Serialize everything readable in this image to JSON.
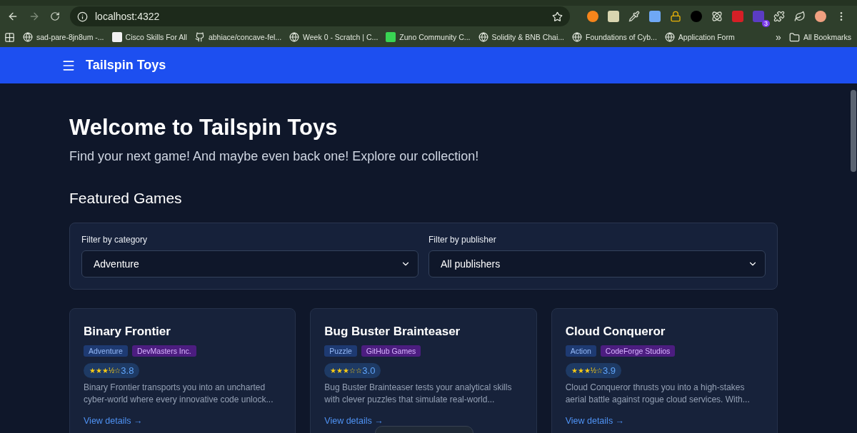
{
  "browser": {
    "url": "localhost:4322",
    "extension_badge": "3",
    "bookmarks": [
      {
        "label": "sad-pare-8jn8um -...",
        "kind": "globe"
      },
      {
        "label": "Cisco Skills For All",
        "kind": "square"
      },
      {
        "label": "abhiace/concave-fel...",
        "kind": "github"
      },
      {
        "label": "Week 0 - Scratch | C...",
        "kind": "globe"
      },
      {
        "label": "Zuno Community C...",
        "kind": "green"
      },
      {
        "label": "Solidity & BNB Chai...",
        "kind": "globe"
      },
      {
        "label": "Foundations of Cyb...",
        "kind": "globe"
      },
      {
        "label": "Application Form",
        "kind": "globe"
      }
    ],
    "more": "»",
    "all_bookmarks": "All Bookmarks"
  },
  "header": {
    "title": "Tailspin Toys"
  },
  "hero": {
    "title": "Welcome to Tailspin Toys",
    "subtitle": "Find your next game! And maybe even back one! Explore our collection!"
  },
  "section_title": "Featured Games",
  "filters": [
    {
      "label": "Filter by category",
      "value": "Adventure"
    },
    {
      "label": "Filter by publisher",
      "value": "All publishers"
    }
  ],
  "games": [
    {
      "title": "Binary Frontier",
      "category": "Adventure",
      "publisher": "DevMasters Inc.",
      "stars_text": "★★★½☆",
      "rating": "3.8",
      "description": "Binary Frontier transports you into an uncharted cyber-world where every innovative code unlock...",
      "link": "View details →"
    },
    {
      "title": "Bug Buster Brainteaser",
      "category": "Puzzle",
      "publisher": "GitHub Games",
      "stars_text": "★★★☆☆",
      "rating": "3.0",
      "description": "Bug Buster Brainteaser tests your analytical skills with clever puzzles that simulate real-world...",
      "link": "View details →"
    },
    {
      "title": "Cloud Conqueror",
      "category": "Action",
      "publisher": "CodeForge Studios",
      "stars_text": "★★★½☆",
      "rating": "3.9",
      "description": "Cloud Conqueror thrusts you into a high-stakes aerial battle against rogue cloud services. With...",
      "link": "View details →"
    }
  ]
}
